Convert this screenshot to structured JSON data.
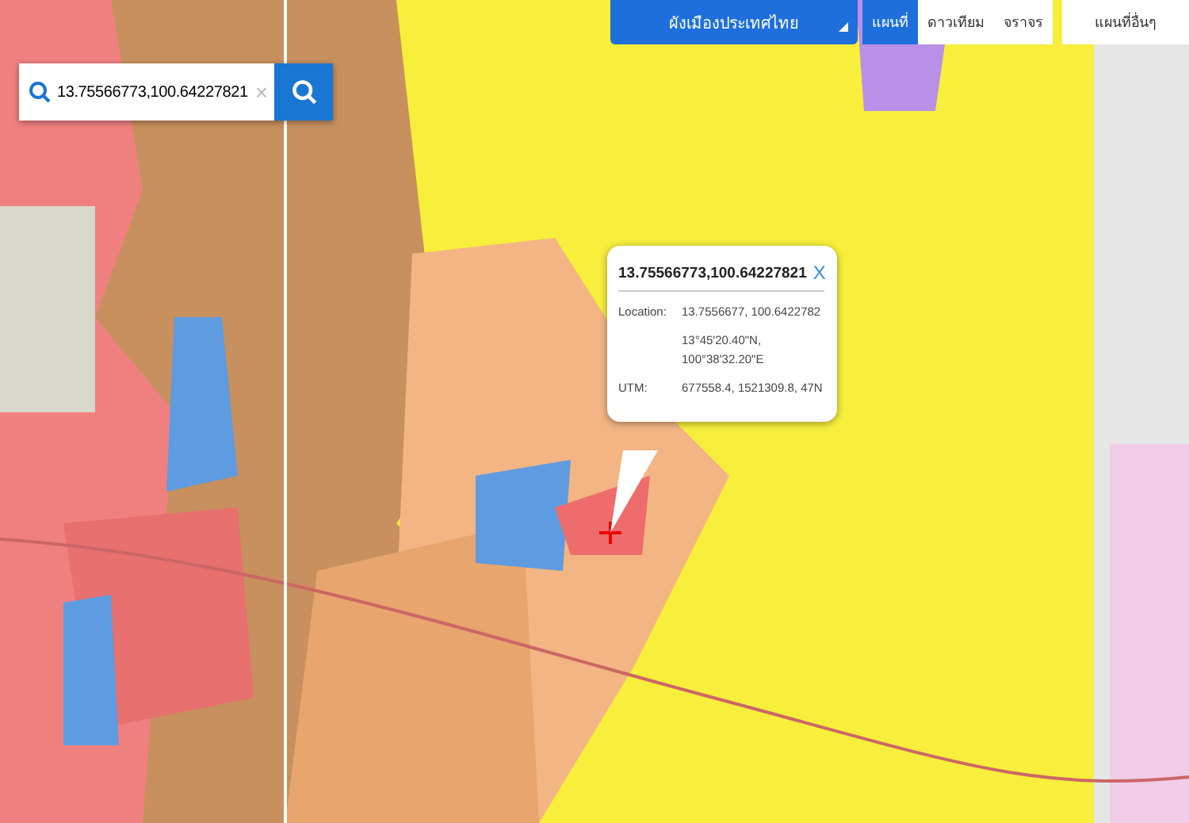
{
  "search": {
    "value": "13.75566773,100.64227821",
    "clear": "×"
  },
  "layer_dropdown": {
    "value": "ผังเมืองประเทศไทย"
  },
  "map_tabs": [
    {
      "label": "แผนที่",
      "selected": true
    },
    {
      "label": "ดาวเทียม",
      "selected": false
    },
    {
      "label": "จราจร",
      "selected": false
    },
    {
      "label": "แผนที่อื่นๆ",
      "selected": false
    }
  ],
  "popup": {
    "title": "13.75566773,100.64227821",
    "close": "X",
    "rows": [
      {
        "label": "Location:",
        "lines": [
          "13.7556677, 100.6422782"
        ]
      },
      {
        "label": "",
        "lines": [
          "13°45'20.40\"N,",
          "100°38'32.20\"E"
        ]
      },
      {
        "label": "UTM:",
        "lines": [
          "677558.4, 1521309.8, 47N"
        ]
      }
    ]
  }
}
